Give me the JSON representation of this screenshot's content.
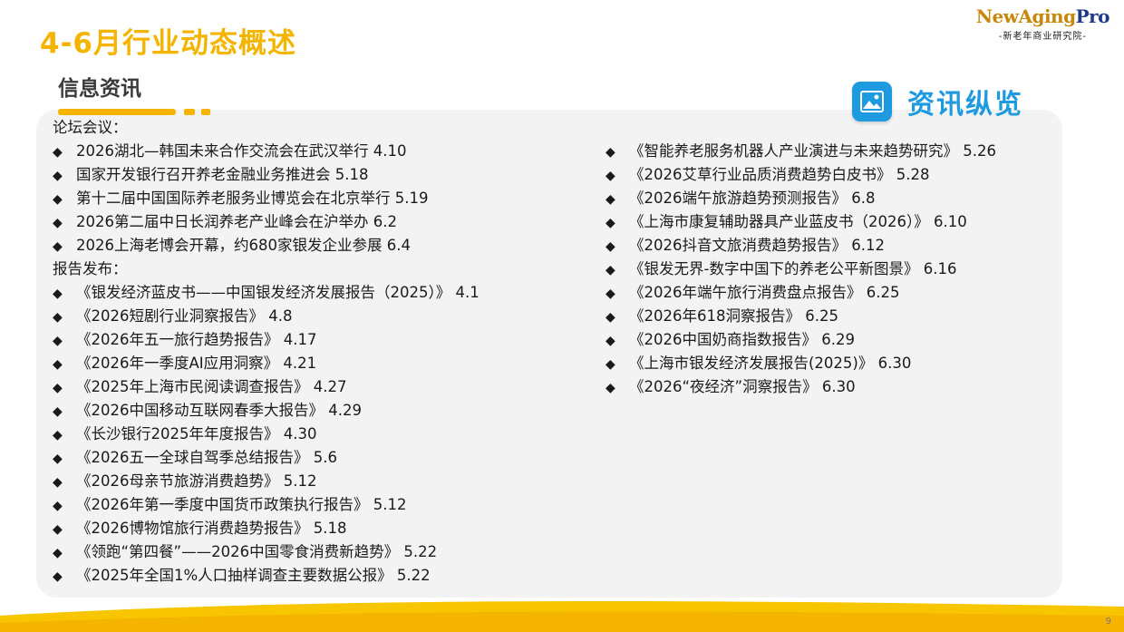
{
  "header": {
    "title": "4-6月行业动态概述",
    "subtitle": "信息资讯"
  },
  "logo": {
    "brand_part1": "NewAging",
    "brand_part2": "Pro",
    "tagline": "-新老年商业研究院-"
  },
  "badge": {
    "icon": "image-icon",
    "label": "资讯纵览"
  },
  "colors": {
    "accent_yellow": "#f5b400",
    "badge_blue": "#1e9ae0",
    "panel_bg": "#f3f3f3"
  },
  "left_column": [
    {
      "type": "heading",
      "text": "论坛会议："
    },
    {
      "type": "item",
      "text": "2026湖北—韩国未来合作交流会在武汉举行 4.10"
    },
    {
      "type": "item",
      "text": "国家开发银行召开养老金融业务推进会 5.18"
    },
    {
      "type": "item",
      "text": "第十二届中国国际养老服务业博览会在北京举行 5.19"
    },
    {
      "type": "item",
      "text": "2026第二届中日长润养老产业峰会在沪举办 6.2"
    },
    {
      "type": "item",
      "text": "2026上海老博会开幕，约680家银发企业参展 6.4"
    },
    {
      "type": "heading",
      "text": "报告发布："
    },
    {
      "type": "item",
      "text": "《银发经济蓝皮书——中国银发经济发展报告（2025）》 4.1"
    },
    {
      "type": "item",
      "text": "《2026短剧行业洞察报告》 4.8"
    },
    {
      "type": "item",
      "text": "《2026年五一旅行趋势报告》 4.17"
    },
    {
      "type": "item",
      "text": "《2026年一季度AI应用洞察》 4.21"
    },
    {
      "type": "item",
      "text": "《2025年上海市民阅读调查报告》 4.27"
    },
    {
      "type": "item",
      "text": "《2026中国移动互联网春季大报告》 4.29"
    },
    {
      "type": "item",
      "text": "《长沙银行2025年年度报告》 4.30"
    },
    {
      "type": "item",
      "text": "《2026五一全球自驾季总结报告》 5.6"
    },
    {
      "type": "item",
      "text": "《2026母亲节旅游消费趋势》 5.12"
    },
    {
      "type": "item",
      "text": "《2026年第一季度中国货币政策执行报告》 5.12"
    },
    {
      "type": "item",
      "text": "《2026博物馆旅行消费趋势报告》 5.18"
    },
    {
      "type": "item",
      "text": "《领跑“第四餐”——2026中国零食消费新趋势》 5.22"
    },
    {
      "type": "item",
      "text": "《2025年全国1%人口抽样调查主要数据公报》 5.22"
    }
  ],
  "right_column": [
    {
      "type": "item",
      "text": "《智能养老服务机器人产业演进与未来趋势研究》 5.26"
    },
    {
      "type": "item",
      "text": "《2026艾草行业品质消费趋势白皮书》 5.28"
    },
    {
      "type": "item",
      "text": "《2026端午旅游趋势预测报告》 6.8"
    },
    {
      "type": "item",
      "text": "《上海市康复辅助器具产业蓝皮书（2026）》 6.10"
    },
    {
      "type": "item",
      "text": "《2026抖音文旅消费趋势报告》 6.12"
    },
    {
      "type": "item",
      "text": "《银发无界-数字中国下的养老公平新图景》 6.16"
    },
    {
      "type": "item",
      "text": "《2026年端午旅行消费盘点报告》 6.25"
    },
    {
      "type": "item",
      "text": "《2026年618洞察报告》 6.25"
    },
    {
      "type": "item",
      "text": "《2026中国奶商指数报告》 6.29"
    },
    {
      "type": "item",
      "text": "《上海市银发经济发展报告(2025)》 6.30"
    },
    {
      "type": "item",
      "text": "《2026“夜经济”洞察报告》 6.30"
    }
  ],
  "footer": {
    "page_number": "9"
  }
}
